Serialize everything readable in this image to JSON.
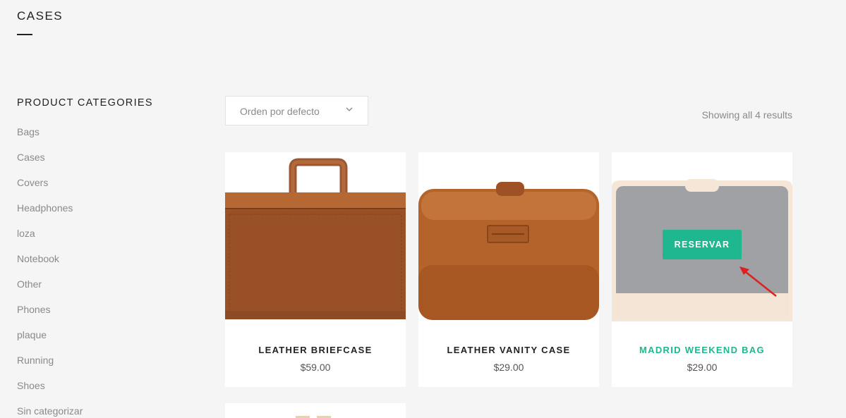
{
  "page": {
    "title": "CASES"
  },
  "sidebar": {
    "heading": "PRODUCT CATEGORIES",
    "categories": [
      "Bags",
      "Cases",
      "Covers",
      "Headphones",
      "loza",
      "Notebook",
      "Other",
      "Phones",
      "plaque",
      "Running",
      "Shoes",
      "Sin categorizar"
    ]
  },
  "toolbar": {
    "sort_label": "Orden por defecto",
    "result_count": "Showing all 4 results"
  },
  "products": [
    {
      "name": "LEATHER BRIEFCASE",
      "price": "$59.00"
    },
    {
      "name": "LEATHER VANITY CASE",
      "price": "$29.00"
    },
    {
      "name": "MADRID WEEKEND BAG",
      "price": "$29.00",
      "button_label": "RESERVAR"
    }
  ],
  "colors": {
    "accent": "#1fb78f",
    "leather": "#a0582c",
    "annotation_arrow": "#e02020"
  },
  "icons": {
    "sort": "chevron-down-icon",
    "annotation": "red-arrow-icon"
  }
}
